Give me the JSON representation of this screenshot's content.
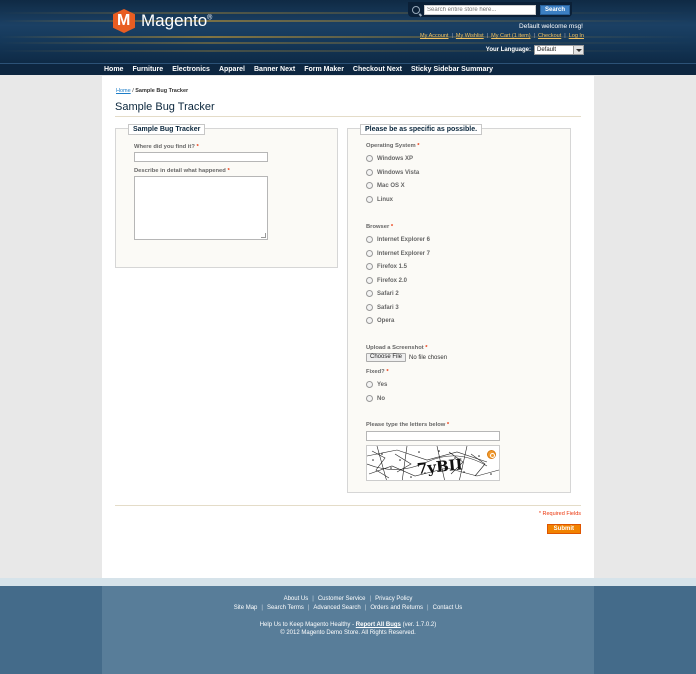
{
  "header": {
    "logo_text": "Magento",
    "logo_reg": "®",
    "search": {
      "placeholder": "Search entire store here...",
      "button": "Search"
    },
    "welcome": "Default welcome msg!",
    "links": [
      "My Account",
      "My Wishlist",
      "My Cart (1 item)",
      "Checkout",
      "Log In"
    ],
    "language_label": "Your Language:",
    "language_value": "Default"
  },
  "nav": [
    "Home",
    "Furniture",
    "Electronics",
    "Apparel",
    "Banner Next",
    "Form Maker",
    "Checkout Next",
    "Sticky Sidebar Summary"
  ],
  "breadcrumb": {
    "home": "Home",
    "separator": "/",
    "current": "Sample Bug Tracker"
  },
  "page_title": "Sample Bug Tracker",
  "left_fieldset": {
    "legend": "Sample Bug Tracker",
    "where_label": "Where did you find it?",
    "where_value": "",
    "describe_label": "Describe in detail what happened",
    "describe_value": "",
    "required_mark": "*"
  },
  "right_fieldset": {
    "legend": "Please be as specific as possible.",
    "os_label": "Operating System",
    "os_options": [
      "Windows XP",
      "Windows Vista",
      "Mac OS X",
      "Linux"
    ],
    "browser_label": "Browser",
    "browser_options": [
      "Internet Explorer 6",
      "Internet Explorer 7",
      "Firefox 1.5",
      "Firefox 2.0",
      "Safari 2",
      "Safari 3",
      "Opera"
    ],
    "upload_label": "Upload a Screenshot",
    "file_button": "Choose File",
    "file_name": "No file chosen",
    "fixed_label": "Fixed?",
    "fixed_options": [
      "Yes",
      "No"
    ],
    "captcha_label": "Please type the letters below",
    "captcha_text": "7yBII",
    "required_mark": "*"
  },
  "required_note": "* Required Fields",
  "submit_label": "Submit",
  "footer": {
    "row1": [
      "About Us",
      "Customer Service",
      "Privacy Policy"
    ],
    "row2": [
      "Site Map",
      "Search Terms",
      "Advanced Search",
      "Orders and Returns",
      "Contact Us"
    ],
    "help_prefix": "Help Us to Keep Magento Healthy -",
    "help_link": "Report All Bugs",
    "help_suffix": "(ver. 1.7.0.2)",
    "copyright": "© 2012 Magento Demo Store. All Rights Reserved."
  },
  "colors": {
    "accent": "#f18200",
    "header_bg": "#163a5c",
    "footer_bg": "#587d99",
    "required": "#eb340a"
  }
}
